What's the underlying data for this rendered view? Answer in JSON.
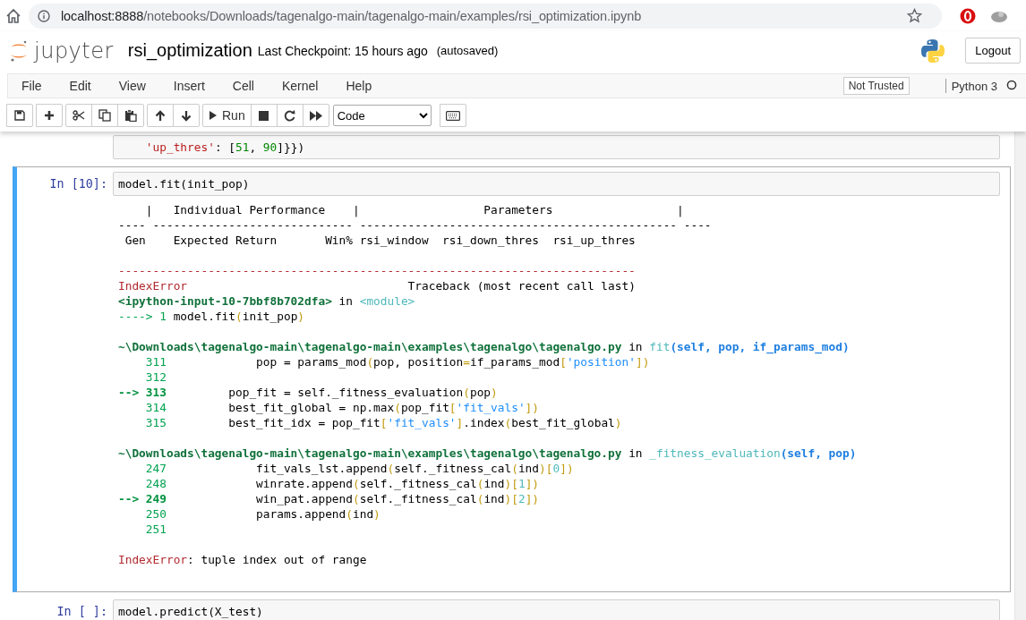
{
  "browser": {
    "url_host": "localhost:8888",
    "url_path": "/notebooks/Downloads/tagenalgo-main/tagenalgo-main/examples/rsi_optimization.ipynb"
  },
  "header": {
    "logo_text": "jupyter",
    "notebook_name": "rsi_optimization",
    "checkpoint": "Last Checkpoint: 15 hours ago",
    "autosave": "(autosaved)",
    "logout": "Logout"
  },
  "menu": [
    "File",
    "Edit",
    "View",
    "Insert",
    "Cell",
    "Kernel",
    "Help"
  ],
  "trust": "Not Trusted",
  "kernel": {
    "name": "Python 3",
    "busy": false
  },
  "toolbar": {
    "run": "Run",
    "cell_type": "Code"
  },
  "cells": [
    {
      "selected": false,
      "input": [
        [
          {
            "kind": "string",
            "text": "    'up_thres'"
          },
          {
            "kind": "plain",
            "text": ": ["
          },
          {
            "kind": "number",
            "text": "51"
          },
          {
            "kind": "plain",
            "text": ", "
          },
          {
            "kind": "number",
            "text": "90"
          },
          {
            "kind": "plain",
            "text": "]}})"
          }
        ]
      ]
    },
    {
      "selected": true,
      "prompt": "In [10]:",
      "input": [
        [
          {
            "kind": "plain",
            "text": "model.fit(init_pop)"
          }
        ]
      ],
      "output": [
        [
          [
            {
              "kind": "plain",
              "text": "    |   Individual Performance    |                  Parameters                  |"
            }
          ],
          [
            {
              "kind": "plain",
              "text": "---- ----------------------------- ---------------------------------------------- ----"
            }
          ],
          [
            {
              "kind": "plain",
              "text": " Gen    Expected Return       Win% rsi_window  rsi_down_thres  rsi_up_thres"
            }
          ]
        ],
        [
          [
            {
              "kind": "error",
              "text": "---------------------------------------------------------------------------"
            }
          ],
          [
            {
              "kind": "error",
              "text": "IndexError"
            },
            {
              "kind": "plain",
              "text": "                                Traceback (most recent call last)"
            }
          ],
          [
            {
              "kind": "path",
              "text": "<ipython-input-10-7bbf8b702dfa>"
            },
            {
              "kind": "plain",
              "text": " in "
            },
            {
              "kind": "func",
              "text": "<module>"
            }
          ],
          [
            {
              "kind": "lineno",
              "text": "----> 1 "
            },
            {
              "kind": "plain",
              "text": "model"
            },
            {
              "kind": "plain",
              "text": ".fit"
            },
            {
              "kind": "paren",
              "text": "("
            },
            {
              "kind": "plain",
              "text": "init_pop"
            },
            {
              "kind": "paren",
              "text": ")"
            }
          ]
        ],
        [
          [
            {
              "kind": "path",
              "text": "~\\Downloads\\tagenalgo-main\\tagenalgo-main\\examples\\tagenalgo\\tagenalgo.py"
            },
            {
              "kind": "plain",
              "text": " in "
            },
            {
              "kind": "func",
              "text": "fit"
            },
            {
              "kind": "args",
              "text": "(self, pop, if_params_mod)"
            }
          ],
          [
            {
              "kind": "lineno",
              "text": "    311"
            },
            {
              "kind": "plain",
              "text": "             pop = params_mod"
            },
            {
              "kind": "paren",
              "text": "("
            },
            {
              "kind": "plain",
              "text": "pop, position"
            },
            {
              "kind": "paren",
              "text": "="
            },
            {
              "kind": "plain",
              "text": "if_params_mod"
            },
            {
              "kind": "paren",
              "text": "["
            },
            {
              "kind": "qstring",
              "text": "'position'"
            },
            {
              "kind": "paren",
              "text": "])"
            }
          ],
          [
            {
              "kind": "lineno",
              "text": "    312"
            }
          ],
          [
            {
              "kind": "arrow",
              "text": "--> 313"
            },
            {
              "kind": "plain",
              "text": "         pop_fit = self._fitness_evaluation"
            },
            {
              "kind": "paren",
              "text": "("
            },
            {
              "kind": "plain",
              "text": "pop"
            },
            {
              "kind": "paren",
              "text": ")"
            }
          ],
          [
            {
              "kind": "lineno",
              "text": "    314"
            },
            {
              "kind": "plain",
              "text": "         best_fit_global = np.max"
            },
            {
              "kind": "paren",
              "text": "("
            },
            {
              "kind": "plain",
              "text": "pop_fit"
            },
            {
              "kind": "paren",
              "text": "["
            },
            {
              "kind": "qstring",
              "text": "'fit_vals'"
            },
            {
              "kind": "paren",
              "text": "])"
            }
          ],
          [
            {
              "kind": "lineno",
              "text": "    315"
            },
            {
              "kind": "plain",
              "text": "         best_fit_idx = pop_fit"
            },
            {
              "kind": "paren",
              "text": "["
            },
            {
              "kind": "qstring",
              "text": "'fit_vals'"
            },
            {
              "kind": "paren",
              "text": "]"
            },
            {
              "kind": "plain",
              "text": ".index"
            },
            {
              "kind": "paren",
              "text": "("
            },
            {
              "kind": "plain",
              "text": "best_fit_global"
            },
            {
              "kind": "paren",
              "text": ")"
            }
          ]
        ],
        [
          [
            {
              "kind": "path",
              "text": "~\\Downloads\\tagenalgo-main\\tagenalgo-main\\examples\\tagenalgo\\tagenalgo.py"
            },
            {
              "kind": "plain",
              "text": " in "
            },
            {
              "kind": "func",
              "text": "_fitness_evaluation"
            },
            {
              "kind": "args",
              "text": "(self, pop)"
            }
          ],
          [
            {
              "kind": "lineno",
              "text": "    247"
            },
            {
              "kind": "plain",
              "text": "             fit_vals_lst.append"
            },
            {
              "kind": "paren",
              "text": "("
            },
            {
              "kind": "plain",
              "text": "self._fitness_cal"
            },
            {
              "kind": "paren",
              "text": "("
            },
            {
              "kind": "plain",
              "text": "ind"
            },
            {
              "kind": "paren",
              "text": ")["
            },
            {
              "kind": "digit",
              "text": "0"
            },
            {
              "kind": "paren",
              "text": "])"
            }
          ],
          [
            {
              "kind": "lineno",
              "text": "    248"
            },
            {
              "kind": "plain",
              "text": "             winrate.append"
            },
            {
              "kind": "paren",
              "text": "("
            },
            {
              "kind": "plain",
              "text": "self._fitness_cal"
            },
            {
              "kind": "paren",
              "text": "("
            },
            {
              "kind": "plain",
              "text": "ind"
            },
            {
              "kind": "paren",
              "text": ")["
            },
            {
              "kind": "digit",
              "text": "1"
            },
            {
              "kind": "paren",
              "text": "])"
            }
          ],
          [
            {
              "kind": "arrow",
              "text": "--> 249"
            },
            {
              "kind": "plain",
              "text": "             win_pat.append"
            },
            {
              "kind": "paren",
              "text": "("
            },
            {
              "kind": "plain",
              "text": "self._fitness_cal"
            },
            {
              "kind": "paren",
              "text": "("
            },
            {
              "kind": "plain",
              "text": "ind"
            },
            {
              "kind": "paren",
              "text": ")["
            },
            {
              "kind": "digit",
              "text": "2"
            },
            {
              "kind": "paren",
              "text": "])"
            }
          ],
          [
            {
              "kind": "lineno",
              "text": "    250"
            },
            {
              "kind": "plain",
              "text": "             params.append"
            },
            {
              "kind": "paren",
              "text": "("
            },
            {
              "kind": "plain",
              "text": "ind"
            },
            {
              "kind": "paren",
              "text": ")"
            }
          ],
          [
            {
              "kind": "lineno",
              "text": "    251"
            }
          ]
        ],
        [
          [
            {
              "kind": "error",
              "text": "IndexError"
            },
            {
              "kind": "plain",
              "text": ": tuple index out of range"
            }
          ]
        ]
      ]
    },
    {
      "selected": false,
      "prompt": "In [ ]:",
      "input": [
        [
          {
            "kind": "plain",
            "text": "model.predict(X_test)"
          }
        ]
      ]
    }
  ]
}
